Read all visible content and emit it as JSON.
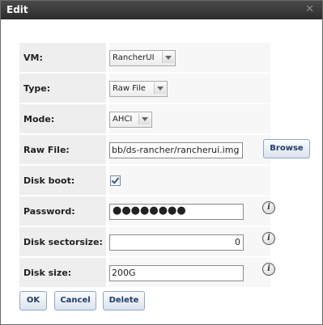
{
  "dialog": {
    "title": "Edit",
    "close_glyph": "✕"
  },
  "fields": {
    "vm": {
      "label": "VM:",
      "value": "RancherUI"
    },
    "type": {
      "label": "Type:",
      "value": "Raw File"
    },
    "mode": {
      "label": "Mode:",
      "value": "AHCI"
    },
    "raw_file": {
      "label": "Raw File:",
      "value": "bb/ds-rancher/rancherui.img",
      "browse_label": "Browse"
    },
    "disk_boot": {
      "label": "Disk boot:",
      "checked": true
    },
    "password": {
      "label": "Password:",
      "masked": "●●●●●●●●"
    },
    "disk_sectorsize": {
      "label": "Disk sectorsize:",
      "value": "0"
    },
    "disk_size": {
      "label": "Disk size:",
      "value": "200G"
    }
  },
  "buttons": {
    "ok": "OK",
    "cancel": "Cancel",
    "delete": "Delete"
  },
  "icons": {
    "info": "i",
    "info_icon_name": "info-icon"
  }
}
